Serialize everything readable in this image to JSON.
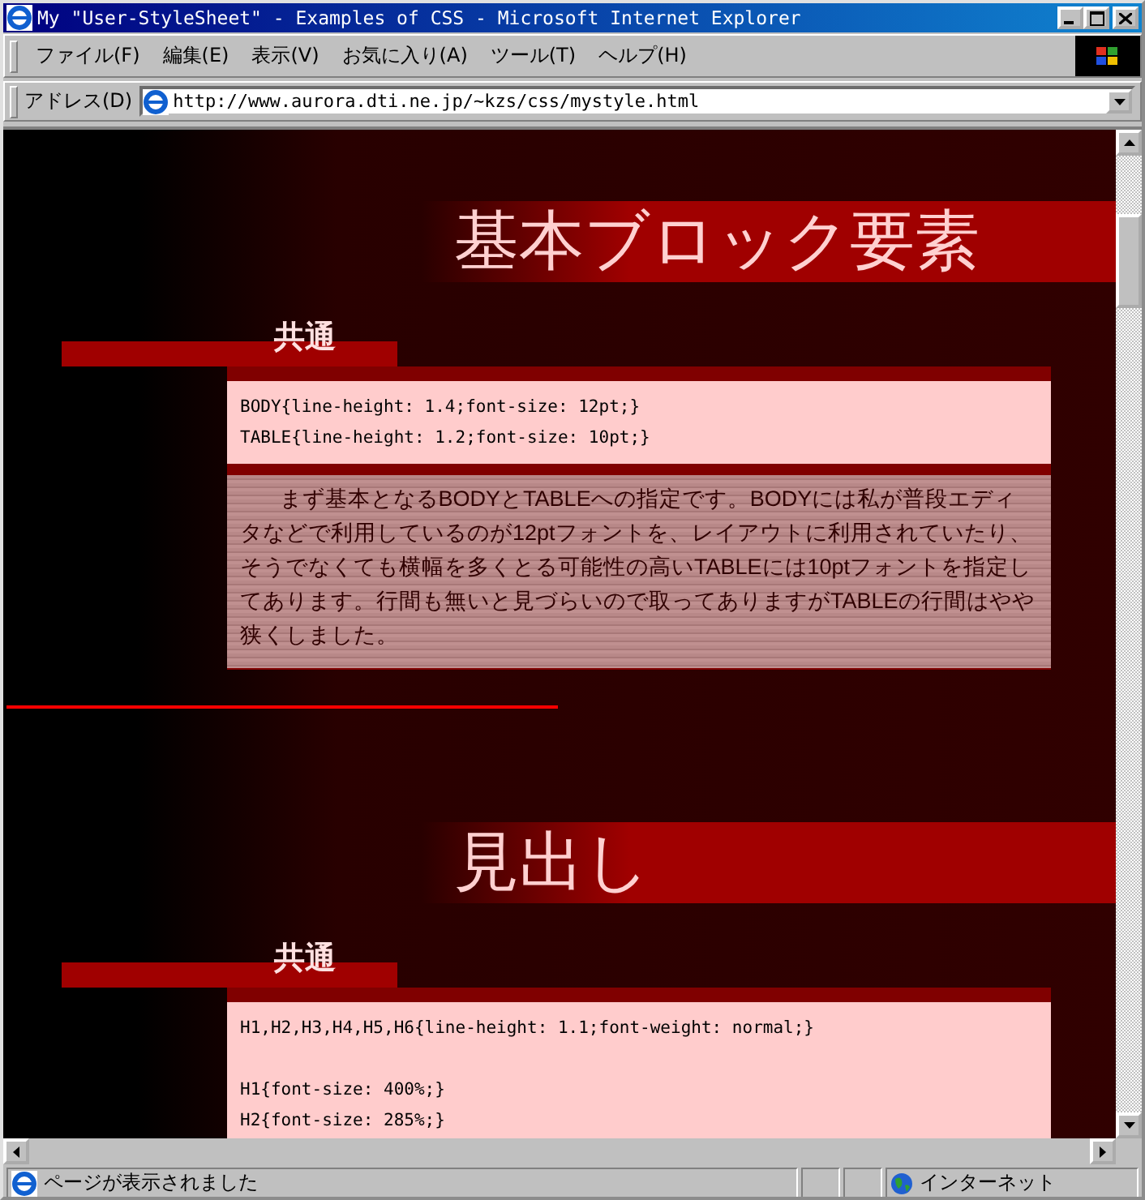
{
  "window": {
    "title": "My \"User-StyleSheet\" - Examples of CSS - Microsoft Internet Explorer"
  },
  "menu": [
    "ファイル(F)",
    "編集(E)",
    "表示(V)",
    "お気に入り(A)",
    "ツール(T)",
    "ヘルプ(H)"
  ],
  "address_bar": {
    "label": "アドレス(D)",
    "value": "http://www.aurora.dti.ne.jp/~kzs/css/mystyle.html"
  },
  "sections": [
    {
      "heading": "基本ブロック要素",
      "subheading": "共通",
      "code_groups": [
        [
          "BODY{line-height: 1.4;font-size: 12pt;}",
          "TABLE{line-height: 1.2;font-size: 10pt;}"
        ]
      ],
      "paragraph": "まず基本となるBODYとTABLEへの指定です。BODYには私が普段エディタなどで利用しているのが12ptフォントを、レイアウトに利用されていたり、そうでなくても横幅を多くとる可能性の高いTABLEには10ptフォントを指定してあります。行間も無いと見づらいので取ってありますがTABLEの行間はやや狭くしました。"
    },
    {
      "heading": "見出し",
      "subheading": "共通",
      "code_groups": [
        [
          "H1,H2,H3,H4,H5,H6{line-height: 1.1;font-weight: normal;}"
        ],
        [
          "H1{font-size: 400%;}",
          "H2{font-size: 285%;}"
        ]
      ]
    }
  ],
  "status_bar": {
    "text": "ページが表示されました",
    "zone": "インターネット"
  }
}
